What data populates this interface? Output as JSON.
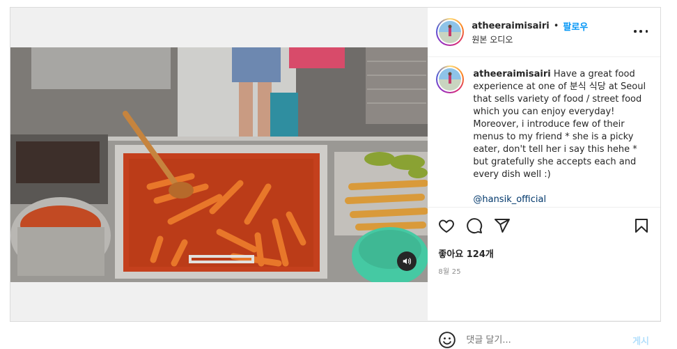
{
  "user": {
    "username": "atheeraimisairi",
    "separator": "•",
    "follow_label": "팔로우",
    "audio_label": "원본 오디오"
  },
  "caption": {
    "username": "atheeraimisairi",
    "text": " Have a great food experience at one of 분식 식당 at Seoul that sells variety of food / street food which you can enjoy everyday! Moreover, i introduce few of their menus to my friend * she is a picky eater, don't tell her i say this hehe * but gratefully she accepts each and every dish well :)",
    "mention": "@hansik_official"
  },
  "stats": {
    "likes": "좋아요 124개",
    "date": "8월 25"
  },
  "comment": {
    "placeholder": "댓글 달기...",
    "post_label": "게시"
  },
  "icons": {
    "more": "more-options-icon",
    "like": "heart-icon",
    "comment": "comment-icon",
    "share": "share-icon",
    "save": "bookmark-icon",
    "emoji": "emoji-icon",
    "sound": "speaker-icon"
  },
  "colors": {
    "accent": "#0095f6",
    "post_disabled": "#b2dffc",
    "mention": "#00376b",
    "border": "#dbdbdb"
  }
}
